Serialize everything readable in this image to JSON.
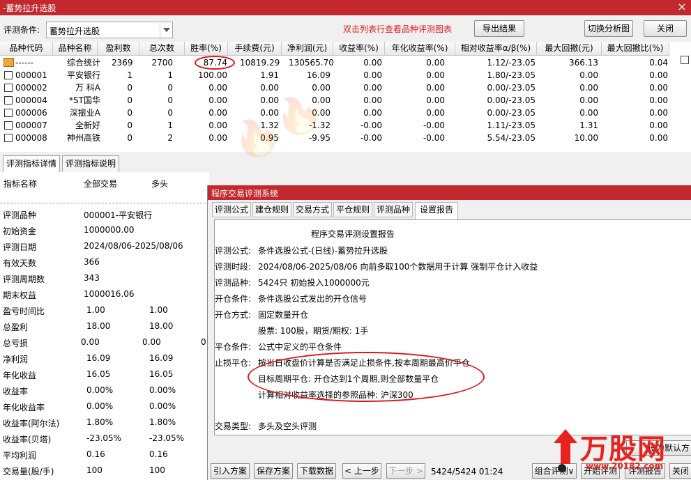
{
  "window": {
    "title": "-蓄势拉升选股",
    "close_glyph": "×"
  },
  "toolbar": {
    "condition_label": "评测条件:",
    "condition_value": "蓄势拉升选股",
    "hint": "双击列表行查看品种评测图表",
    "export_label": "导出结果",
    "switch_chart_label": "切换分析图",
    "close_label": "关闭"
  },
  "grid": {
    "columns": [
      "品种代码",
      "品种名称",
      "盈利数",
      "总次数",
      "胜率(%)",
      "手续费(元)",
      "净利润(元)",
      "收益率(%)",
      "年化收益率(%)",
      "相对收益率α/β(%)",
      "最大回撤(元)",
      "最大回撤比(%)"
    ],
    "rows": [
      [
        "------",
        "综合统计",
        "2369",
        "2700",
        "87.74",
        "10819.29",
        "130565.70",
        "0.00",
        "0.00",
        "1.12/-23.05",
        "366.13",
        "0.04"
      ],
      [
        "000001",
        "平安银行",
        "1",
        "1",
        "100.00",
        "1.91",
        "16.09",
        "0.00",
        "0.00",
        "1.80/-23.05",
        "0.00",
        "0.00"
      ],
      [
        "000002",
        "万 科A",
        "0",
        "0",
        "0.00",
        "0.00",
        "0.00",
        "0.00",
        "0.00",
        "0.00/-23.05",
        "0.00",
        "0.00"
      ],
      [
        "000004",
        "*ST国华",
        "0",
        "0",
        "0.00",
        "0.00",
        "0.00",
        "0.00",
        "0.00",
        "0.00/-23.05",
        "0.00",
        "0.00"
      ],
      [
        "000006",
        "深振业A",
        "0",
        "0",
        "0.00",
        "0.00",
        "0.00",
        "0.00",
        "0.00",
        "0.00/-23.05",
        "0.00",
        "0.00"
      ],
      [
        "000007",
        "全新好",
        "0",
        "1",
        "0.00",
        "1.32",
        "-1.32",
        "-0.00",
        "-0.00",
        "1.11/-23.05",
        "1.31",
        "0.00"
      ],
      [
        "000008",
        "神州高铁",
        "0",
        "2",
        "0.00",
        "0.95",
        "-9.95",
        "-0.00",
        "-0.00",
        "5.54/-23.05",
        "10.00",
        "0.00"
      ]
    ]
  },
  "left_tabs": {
    "detail": "评测指标详情",
    "explain": "评测指标说明"
  },
  "left_panel": {
    "headers": [
      "指标名称",
      "全部交易",
      "多头",
      "空头"
    ],
    "rows": [
      [
        "评测品种",
        "000001-平安银行",
        "",
        ""
      ],
      [
        "初始资金",
        "1000000.00",
        "",
        ""
      ],
      [
        "评测日期",
        "2024/08/06-2025/08/06",
        "",
        ""
      ],
      [
        "有效天数",
        "366",
        "",
        ""
      ],
      [
        "评测周期数",
        "343",
        "",
        ""
      ],
      [
        "期末权益",
        "1000016.06",
        "",
        ""
      ],
      [
        "盈亏时间比",
        "1.00",
        "1.00",
        ""
      ],
      [
        "总盈利",
        "18.00",
        "18.00",
        ""
      ],
      [
        "总亏损",
        "0.00",
        "0.00",
        "0.00"
      ],
      [
        "净利润",
        "16.09",
        "16.09",
        ""
      ],
      [
        "年化收益",
        "16.05",
        "16.05",
        ""
      ],
      [
        "收益率",
        "0.00%",
        "0.00%",
        ""
      ],
      [
        "年化收益率",
        "0.00%",
        "0.00%",
        ""
      ],
      [
        "收益率(阿尔法)",
        "1.80%",
        "1.80%",
        ""
      ],
      [
        "收益率(贝塔)",
        "-23.05%",
        "-23.05%",
        ""
      ],
      [
        "平均利润",
        "0.16",
        "0.16",
        ""
      ],
      [
        "交易量(股/手)",
        "100",
        "100",
        ""
      ]
    ]
  },
  "dialog": {
    "title": "程序交易评测系统",
    "tabs": [
      "评测公式",
      "建仓规则",
      "交易方式",
      "平仓规则",
      "评测品种",
      "设置报告"
    ],
    "report": {
      "heading": "程序交易评测设置报告",
      "formula_k": "评测公式:",
      "formula_v": "条件选股公式-(日线)-蓄势拉升选股",
      "period_k": "评测时段:",
      "period_v": "2024/08/06-2025/08/06 向前多取100个数据用于计算 强制平仓计入收益",
      "symbols_k": "评测品种:",
      "symbols_v": "5424只 初始投入1000000元",
      "open_cond_k": "开仓条件:",
      "open_cond_v": "条件选股公式发出的开仓信号",
      "open_mode_k": "开仓方式:",
      "open_mode_v": "固定数量开仓",
      "open_mode_v2": "股票: 100股，期货/期权: 1手",
      "close_cond_k": "平仓条件:",
      "close_cond_v": "公式中定义的平仓条件",
      "stop_k": "止损平仓:",
      "stop_v": "按当日收盘价计算是否满足止损条件,按本周期最高价平仓",
      "target_v": "目标周期平仓: 开仓达到1个周期,则全部数量平仓",
      "bench_v": "计算相对收益率选择的参照品种: 沪深300",
      "trade_k": "交易类型:",
      "trade_v": "多头及空头评测"
    },
    "footer": {
      "import": "引入方案",
      "save": "保存方案",
      "download": "下载数据",
      "prev": "< 上一步",
      "next": "下一步 >",
      "progress": "5424/5424  01:24",
      "group": "组合评测∨",
      "start": "开始评测",
      "report": "评测报告",
      "close": "关闭",
      "set_default": "设为默认方"
    }
  },
  "logo": {
    "text": "万股网",
    "url": "www.20182.com"
  },
  "colors": {
    "title_bar": "#c3282e",
    "hint": "#e02020",
    "oval": "#e0141e",
    "logo": "#e8221c"
  }
}
